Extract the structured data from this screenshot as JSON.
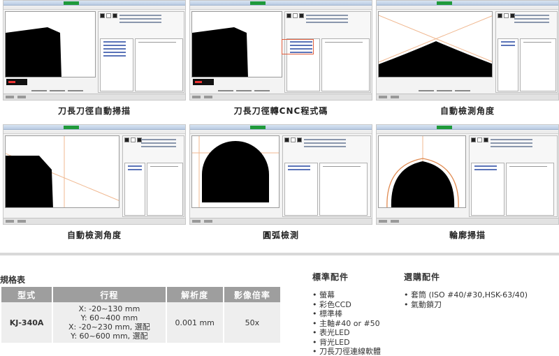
{
  "gallery": {
    "items": [
      {
        "caption": "刀長刀徑自動掃描",
        "view": "tool-edge"
      },
      {
        "caption": "刀長刀徑轉CNC程式碼",
        "view": "tool-edge-code"
      },
      {
        "caption": "自動檢測角度",
        "view": "cone"
      },
      {
        "caption": "自動檢測角度",
        "view": "angle"
      },
      {
        "caption": "圓弧檢測",
        "view": "arc"
      },
      {
        "caption": "輪廓掃描",
        "view": "contour"
      }
    ]
  },
  "spec_table": {
    "title": "規格表",
    "headers": [
      "型式",
      "行程",
      "解析度",
      "影像倍率"
    ],
    "row": {
      "model": "KJ-340A",
      "stroke": [
        "X: -20~130 mm",
        "Y: 60~400 mm",
        "X: -20~230 mm, 選配",
        "Y: 60~600 mm, 選配"
      ],
      "resolution": "0.001 mm",
      "magnification": "50x"
    }
  },
  "standard_accessories": {
    "title": "標準配件",
    "items": [
      "螢幕",
      "彩色CCD",
      "標準棒",
      "主軸#40 or #50",
      "表光LED",
      "背光LED",
      "刀長刀徑連線軟體"
    ]
  },
  "optional_accessories": {
    "title": "選購配件",
    "items": [
      "套筒 (ISO #40/#30,HSK-63/40)",
      "氣動鎖刀"
    ]
  },
  "colors": {
    "header_bg": "#9e9e9e",
    "cell_bg": "#eeeeee",
    "divider": "#d9d9d9",
    "window_accent": "#1f9a3b",
    "guide_line": "#f0b890",
    "highlight": "#e06040"
  }
}
